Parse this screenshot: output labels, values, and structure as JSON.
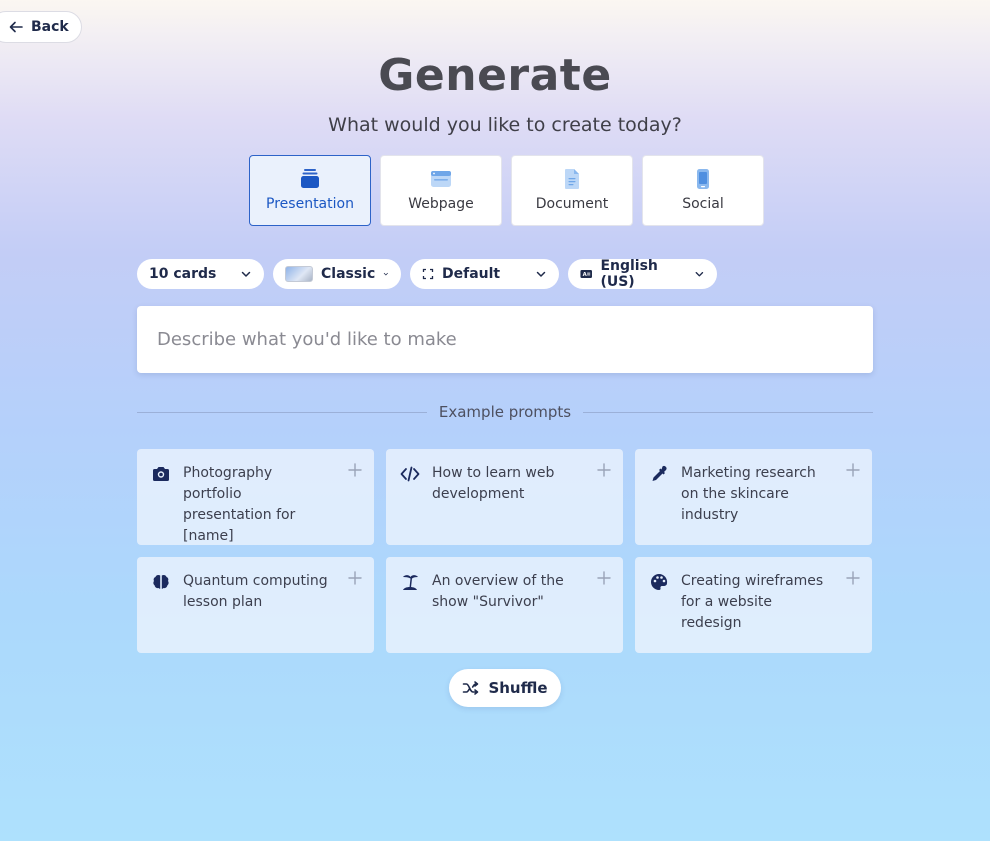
{
  "header": {
    "back_label": "Back",
    "title": "Generate",
    "subtitle": "What would you like to create today?"
  },
  "types": [
    {
      "label": "Presentation",
      "icon": "presentation-icon",
      "active": true
    },
    {
      "label": "Webpage",
      "icon": "webpage-icon",
      "active": false
    },
    {
      "label": "Document",
      "icon": "document-icon",
      "active": false
    },
    {
      "label": "Social",
      "icon": "social-icon",
      "active": false
    }
  ],
  "options": {
    "cards": "10 cards",
    "theme": "Classic",
    "layout": "Default",
    "language": "English (US)"
  },
  "prompt": {
    "placeholder": "Describe what you'd like to make",
    "value": ""
  },
  "examples_label": "Example prompts",
  "examples": [
    {
      "text": "Photography portfolio presentation for [name]",
      "icon": "camera-icon"
    },
    {
      "text": "How to learn web development",
      "icon": "code-icon"
    },
    {
      "text": "Marketing research on the skincare industry",
      "icon": "dropper-icon"
    },
    {
      "text": "Quantum computing lesson plan",
      "icon": "brain-icon"
    },
    {
      "text": "An overview of the show \"Survivor\"",
      "icon": "island-icon"
    },
    {
      "text": "Creating wireframes for a website redesign",
      "icon": "palette-icon"
    }
  ],
  "shuffle_label": "Shuffle",
  "colors": {
    "accent": "#1b57c3",
    "dark_text": "#1f2a4a",
    "icon_navy": "#1b2a5e"
  }
}
